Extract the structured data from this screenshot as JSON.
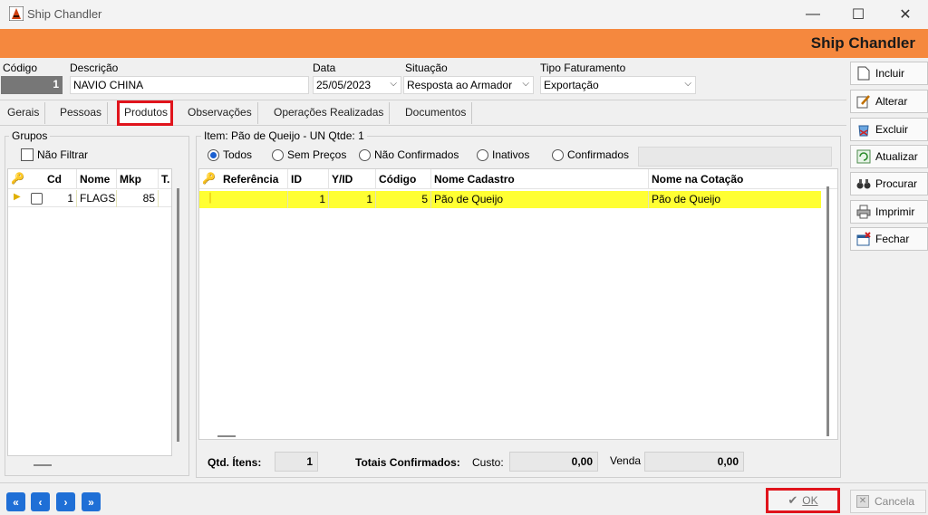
{
  "window": {
    "title": "Ship Chandler",
    "banner_title": "Ship Chandler"
  },
  "header": {
    "codigo": {
      "label": "Código",
      "value": "1"
    },
    "descricao": {
      "label": "Descrição",
      "value": "NAVIO CHINA"
    },
    "data": {
      "label": "Data",
      "value": "25/05/2023"
    },
    "situacao": {
      "label": "Situação",
      "value": "Resposta ao Armador"
    },
    "tipo_faturamento": {
      "label": "Tipo Faturamento",
      "value": "Exportação"
    }
  },
  "tabs": [
    {
      "label": "Gerais"
    },
    {
      "label": "Pessoas"
    },
    {
      "label": "Produtos",
      "active": true
    },
    {
      "label": "Observações"
    },
    {
      "label": "Operações Realizadas"
    },
    {
      "label": "Documentos"
    }
  ],
  "groups": {
    "title": "Grupos",
    "nao_filtrar": "Não Filtrar",
    "columns": [
      "Cd",
      "Nome",
      "Mkp",
      "T."
    ],
    "rows": [
      {
        "cd": "1",
        "nome": "FLAGS",
        "mkp": "85"
      }
    ]
  },
  "items": {
    "title": "Item: Pão de Queijo - UN Qtde: 1",
    "filters": [
      {
        "label": "Todos",
        "selected": true
      },
      {
        "label": "Sem Preços",
        "selected": false
      },
      {
        "label": "Não Confirmados",
        "selected": false
      },
      {
        "label": "Inativos",
        "selected": false
      },
      {
        "label": "Confirmados",
        "selected": false
      }
    ],
    "columns": [
      "Referência",
      "ID",
      "Y/ID",
      "Código",
      "Nome Cadastro",
      "Nome na Cotação"
    ],
    "rows": [
      {
        "referencia": "",
        "id": "1",
        "yid": "1",
        "codigo": "5",
        "nome_cadastro": "Pão de Queijo",
        "nome_cotacao": "Pão de Queijo"
      }
    ],
    "highlight_color": "#ffff33"
  },
  "totals": {
    "qtd_label": "Qtd. Ítens:",
    "qtd_value": "1",
    "confirmados_label": "Totais Confirmados:",
    "custo_label": "Custo:",
    "custo_value": "0,00",
    "venda_label": "Venda",
    "venda_value": "0,00"
  },
  "side_buttons": [
    {
      "label": "Incluir",
      "icon": "document-icon"
    },
    {
      "label": "Alterar",
      "icon": "edit-icon"
    },
    {
      "label": "Excluir",
      "icon": "delete-icon"
    },
    {
      "label": "Atualizar",
      "icon": "refresh-icon"
    },
    {
      "label": "Procurar",
      "icon": "binoculars-icon"
    },
    {
      "label": "Imprimir",
      "icon": "printer-icon"
    },
    {
      "label": "Fechar",
      "icon": "close-window-icon"
    }
  ],
  "footer": {
    "ok_label": "OK",
    "cancel_label": "Cancela"
  },
  "colors": {
    "banner": "#f5883e",
    "highlight_border": "#e0141c",
    "nav_button": "#1f6fd6"
  }
}
